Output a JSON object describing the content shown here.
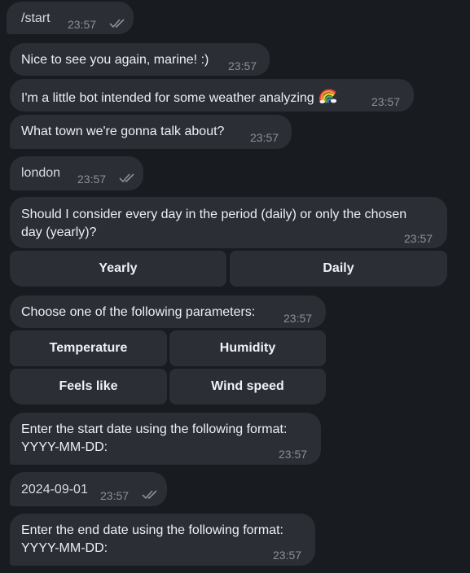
{
  "messages": {
    "m1": {
      "text": "/start",
      "time": "23:57",
      "status": "read"
    },
    "m2": {
      "text": "Nice to see you again, marine! :)",
      "time": "23:57"
    },
    "m3": {
      "text": "I'm a little bot intended for some weather analyzing",
      "emoji": "rainbow",
      "time": "23:57"
    },
    "m4": {
      "text": "What town we're gonna talk about?",
      "time": "23:57"
    },
    "m5": {
      "text": "london",
      "time": "23:57",
      "status": "read"
    },
    "m6": {
      "line1": "Should I consider every day in the period (daily) or only the chosen",
      "line2": "day (yearly)?",
      "time": "23:57"
    },
    "m7": {
      "text": "Choose one of the following parameters:",
      "time": "23:57"
    },
    "m8": {
      "line1": "Enter the start date using the following format:",
      "line2": "YYYY-MM-DD:",
      "time": "23:57"
    },
    "m9": {
      "text": "2024-09-01",
      "time": "23:57",
      "status": "read"
    },
    "m10": {
      "line1": "Enter the end date using the following format:",
      "line2": "YYYY-MM-DD:",
      "time": "23:57"
    }
  },
  "keyboards": {
    "period": {
      "yearly": "Yearly",
      "daily": "Daily"
    },
    "params": {
      "temperature": "Temperature",
      "humidity": "Humidity",
      "feels_like": "Feels like",
      "wind_speed": "Wind speed"
    }
  },
  "colors": {
    "background": "#181b20",
    "bubble": "#2b2e34",
    "time": "#8b9099"
  }
}
